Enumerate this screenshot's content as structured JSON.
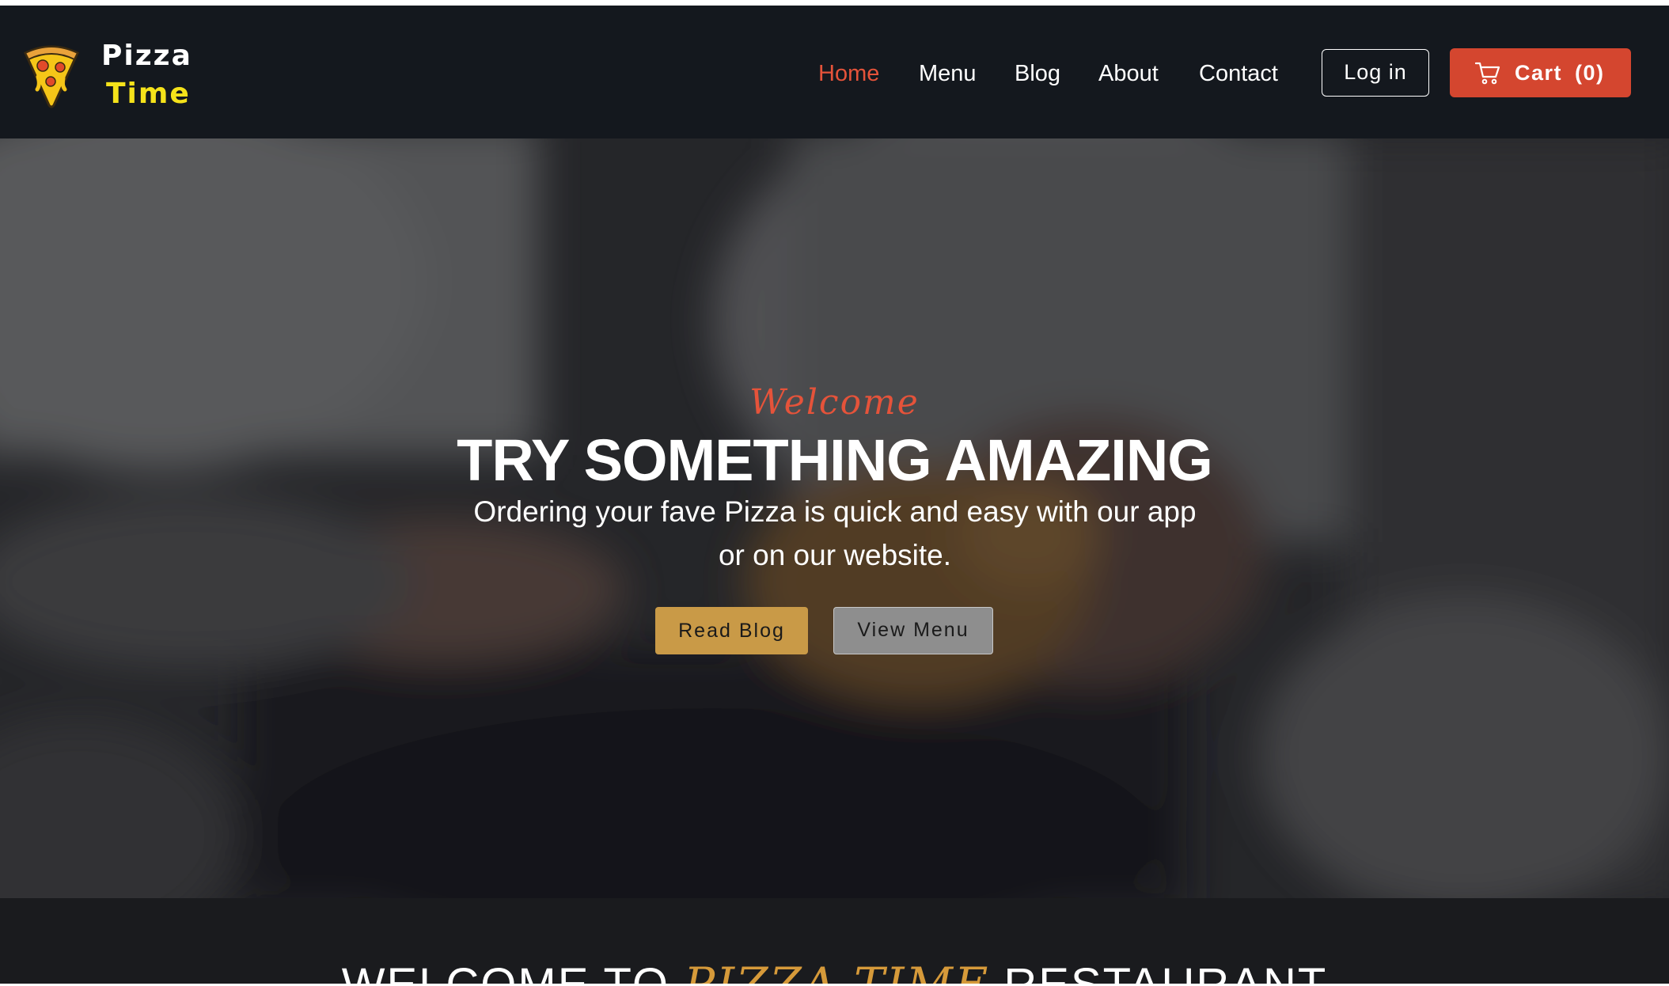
{
  "brand": {
    "line1": "Pizza",
    "line2": "Time",
    "logo_icon": "pizza-slice-icon",
    "accent_color": "#f5e21a"
  },
  "nav": {
    "items": [
      {
        "label": "Home",
        "active": true
      },
      {
        "label": "Menu",
        "active": false
      },
      {
        "label": "Blog",
        "active": false
      },
      {
        "label": "About",
        "active": false
      },
      {
        "label": "Contact",
        "active": false
      }
    ],
    "active_color": "#e5533a"
  },
  "header": {
    "login_label": "Log in",
    "cart_label": "Cart",
    "cart_count": "(0)",
    "cart_icon": "cart-icon",
    "cart_color": "#d4462f"
  },
  "hero": {
    "welcome": "Welcome",
    "title": "TRY SOMETHING AMAZING",
    "subtitle": "Ordering your fave Pizza is quick and easy with our app or on our website.",
    "read_blog_label": "Read Blog",
    "view_menu_label": "View Menu",
    "read_blog_color": "#c99a47"
  },
  "welcome_section": {
    "prefix": "WELCOME TO",
    "accent": "PIZZA TIME",
    "suffix": "RESTAURANT",
    "accent_color": "#d69a3a"
  }
}
